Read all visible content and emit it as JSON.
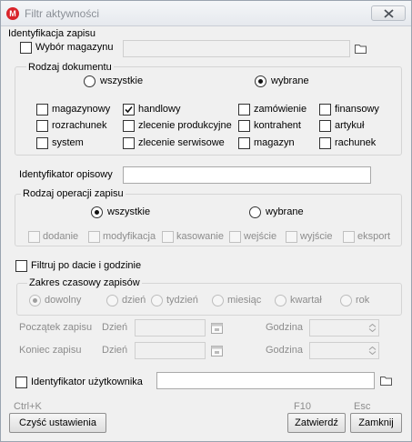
{
  "window": {
    "title": "Filtr aktywności"
  },
  "ident_zapisu": {
    "title": "Identyfikacja zapisu",
    "wybor_magazynu": "Wybór magazynu",
    "rodzaj_dokumentu": {
      "title": "Rodzaj dokumentu",
      "radio_all": "wszystkie",
      "radio_selected": "wybrane",
      "selected": "wybrane",
      "types": [
        [
          "magazynowy",
          "handlowy",
          "zamówienie",
          "finansowy"
        ],
        [
          "rozrachunek",
          "zlecenie produkcyjne",
          "kontrahent",
          "artykuł"
        ],
        [
          "system",
          "zlecenie serwisowe",
          "magazyn",
          "rachunek"
        ]
      ],
      "checked": [
        "handlowy"
      ]
    },
    "ident_opisowy": "Identyfikator opisowy",
    "rodzaj_operacji": {
      "title": "Rodzaj operacji zapisu",
      "radio_all": "wszystkie",
      "radio_selected": "wybrane",
      "selected": "wszystkie",
      "ops": [
        "dodanie",
        "modyfikacja",
        "kasowanie",
        "wejście",
        "wyjście",
        "eksport"
      ]
    }
  },
  "filtr_daty": {
    "label": "Filtruj po dacie i godzinie",
    "zakres": {
      "title": "Zakres czasowy zapisów",
      "options": [
        "dowolny",
        "dzień",
        "tydzień",
        "miesiąc",
        "kwartał",
        "rok"
      ],
      "selected": "dowolny"
    },
    "poczatek": "Początek zapisu",
    "koniec": "Koniec zapisu",
    "dzien": "Dzień",
    "godzina": "Godzina"
  },
  "ident_uzytkownika": "Identyfikator użytkownika",
  "footer": {
    "clear_shortcut": "Ctrl+K",
    "clear_label": "Czyść ustawienia",
    "ok_shortcut": "F10",
    "ok_label": "Zatwierdź",
    "close_shortcut": "Esc",
    "close_label": "Zamknij"
  }
}
